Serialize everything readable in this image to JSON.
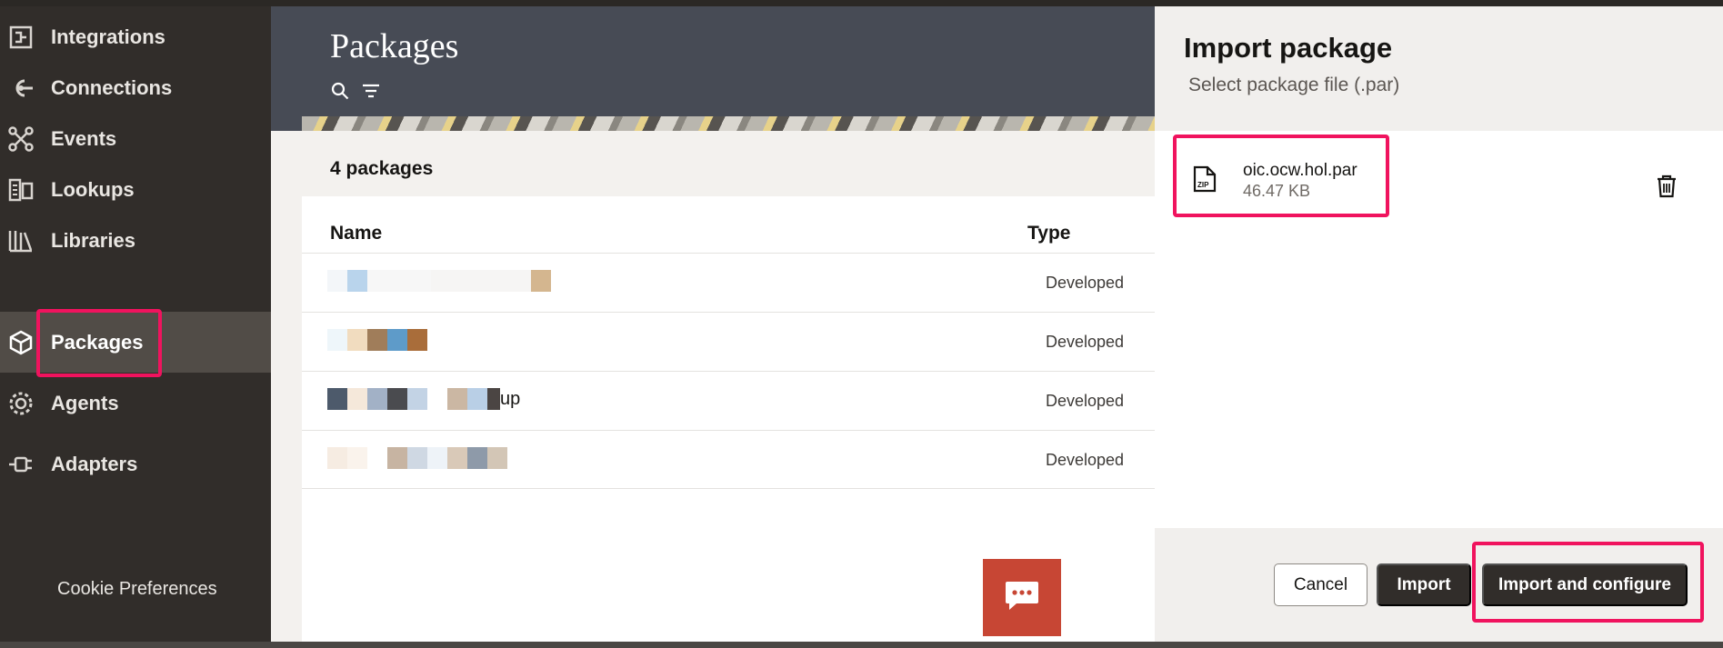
{
  "sidebar": {
    "items": [
      {
        "label": "Integrations",
        "icon": "integrations-icon"
      },
      {
        "label": "Connections",
        "icon": "connections-icon"
      },
      {
        "label": "Events",
        "icon": "events-icon"
      },
      {
        "label": "Lookups",
        "icon": "lookups-icon"
      },
      {
        "label": "Libraries",
        "icon": "libraries-icon"
      },
      {
        "label": "Packages",
        "icon": "packages-icon",
        "active": true
      },
      {
        "label": "Agents",
        "icon": "agents-icon"
      },
      {
        "label": "Adapters",
        "icon": "adapters-icon"
      }
    ],
    "cookie_label": "Cookie Preferences"
  },
  "main": {
    "title": "Packages",
    "count": "4 packages",
    "columns": {
      "name": "Name",
      "type": "Type"
    },
    "rows": [
      {
        "name_visible": "",
        "type": "Developed"
      },
      {
        "name_visible": "",
        "type": "Developed"
      },
      {
        "name_visible": "up",
        "type": "Developed"
      },
      {
        "name_visible": "",
        "type": "Developed"
      }
    ]
  },
  "drawer": {
    "title": "Import package",
    "subtitle": "Select package file (.par)",
    "file": {
      "name": "oic.ocw.hol.par",
      "size": "46.47 KB",
      "icon_text": "ZIP"
    },
    "buttons": {
      "cancel": "Cancel",
      "import": "Import",
      "import_configure": "Import and configure"
    }
  },
  "colors": {
    "highlight": "#f0135e",
    "sidebar_bg": "#312d2a",
    "header_bg": "#474b55",
    "chat_button": "#c74634",
    "primary_button": "#312d2a"
  }
}
